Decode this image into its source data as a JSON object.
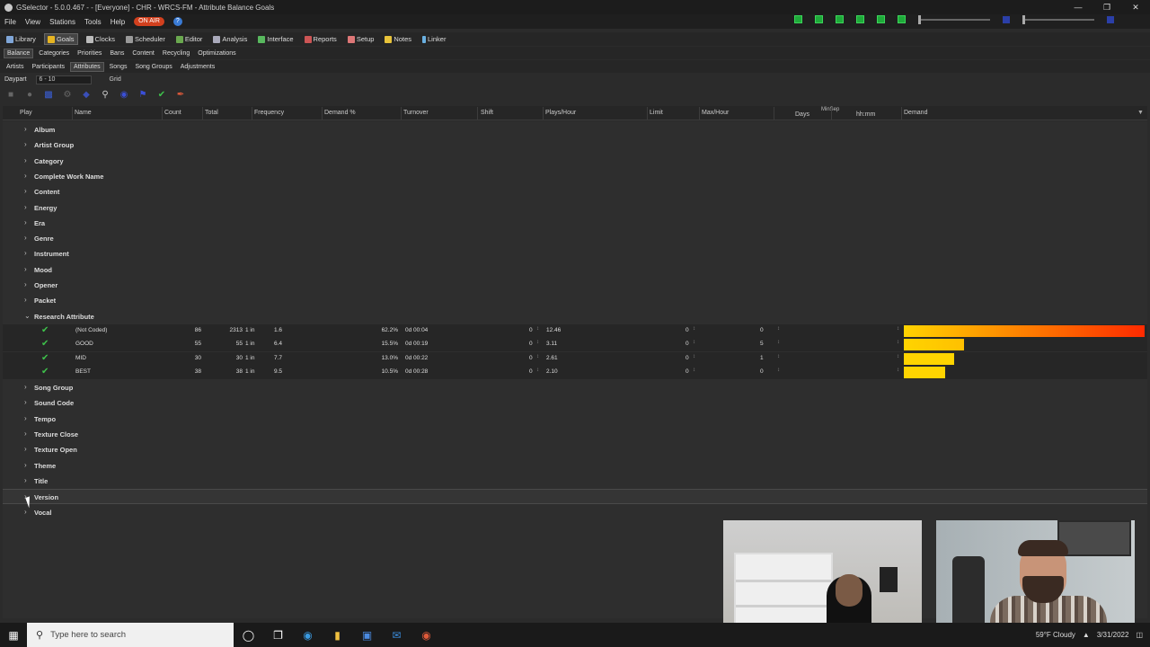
{
  "window": {
    "title": "GSelector - 5.0.0.467 - - [Everyone] - CHR - WRCS-FM - Attribute Balance Goals"
  },
  "menu": {
    "items": [
      "File",
      "View",
      "Stations",
      "Tools",
      "Help"
    ],
    "onair": "ON AIR",
    "help_glyph": "?"
  },
  "toolbar": {
    "items": [
      "Library",
      "Goals",
      "Clocks",
      "Scheduler",
      "Editor",
      "Analysis",
      "Interface",
      "Reports",
      "Setup",
      "Notes",
      "Linker"
    ],
    "active": "Goals"
  },
  "tabs2": {
    "items": [
      "Balance",
      "Categories",
      "Priorities",
      "Bans",
      "Content",
      "Recycling",
      "Optimizations"
    ],
    "active": "Balance"
  },
  "tabs3": {
    "items": [
      "Artists",
      "Participants",
      "Attributes",
      "Songs",
      "Song Groups",
      "Adjustments"
    ],
    "active": "Attributes"
  },
  "daypart": {
    "label": "Daypart",
    "value": "6 - 10",
    "grid_label": "Grid"
  },
  "columns": {
    "play": "Play",
    "name": "Name",
    "count": "Count",
    "total": "Total",
    "frequency": "Frequency",
    "demand_pct": "Demand %",
    "turnover": "Turnover",
    "shift": "Shift",
    "plays_hour": "Plays/Hour",
    "limit": "Limit",
    "max_hour": "Max/Hour",
    "minsep": "MinSep",
    "days": "Days",
    "hhmm": "hh:mm",
    "demand": "Demand"
  },
  "groups_before": [
    "Album",
    "Artist Group",
    "Category",
    "Complete Work Name",
    "Content",
    "Energy",
    "Era",
    "Genre",
    "Instrument",
    "Mood",
    "Opener",
    "Packet"
  ],
  "expanded_group": "Research Attribute",
  "rows": [
    {
      "name": "(Not Coded)",
      "count": "86",
      "total": "2313",
      "freq": "1 in",
      "freq_val": "1.6",
      "demand": "62.2%",
      "turnover": "0d 00:04",
      "shift": "0",
      "plays_hour": "12.46",
      "limit": "0",
      "max_hour": "0",
      "bar_fraction": 1.0,
      "bar_color_from": "#ffd400",
      "bar_color_to": "#ff2a00"
    },
    {
      "name": "GOOD",
      "count": "55",
      "total": "55",
      "freq": "1 in",
      "freq_val": "6.4",
      "demand": "15.5%",
      "turnover": "0d 00:19",
      "shift": "0",
      "plays_hour": "3.11",
      "limit": "0",
      "max_hour": "5",
      "bar_fraction": 0.25,
      "bar_color_from": "#ffd400",
      "bar_color_to": "#ffc000"
    },
    {
      "name": "MID",
      "count": "30",
      "total": "30",
      "freq": "1 in",
      "freq_val": "7.7",
      "demand": "13.0%",
      "turnover": "0d 00:22",
      "shift": "0",
      "plays_hour": "2.61",
      "limit": "0",
      "max_hour": "1",
      "bar_fraction": 0.21,
      "bar_color_from": "#ffd400",
      "bar_color_to": "#ffd400"
    },
    {
      "name": "BEST",
      "count": "38",
      "total": "38",
      "freq": "1 in",
      "freq_val": "9.5",
      "demand": "10.5%",
      "turnover": "0d 00:28",
      "shift": "0",
      "plays_hour": "2.10",
      "limit": "0",
      "max_hour": "0",
      "bar_fraction": 0.17,
      "bar_color_from": "#ffd400",
      "bar_color_to": "#ffd400"
    }
  ],
  "groups_after": [
    "Song Group",
    "Sound Code",
    "Tempo",
    "Texture Close",
    "Texture Open",
    "Theme",
    "Title",
    "Version",
    "Vocal"
  ],
  "taskbar": {
    "search_placeholder": "Type here to search",
    "weather": "59°F Cloudy",
    "date": "3/31/2022"
  }
}
